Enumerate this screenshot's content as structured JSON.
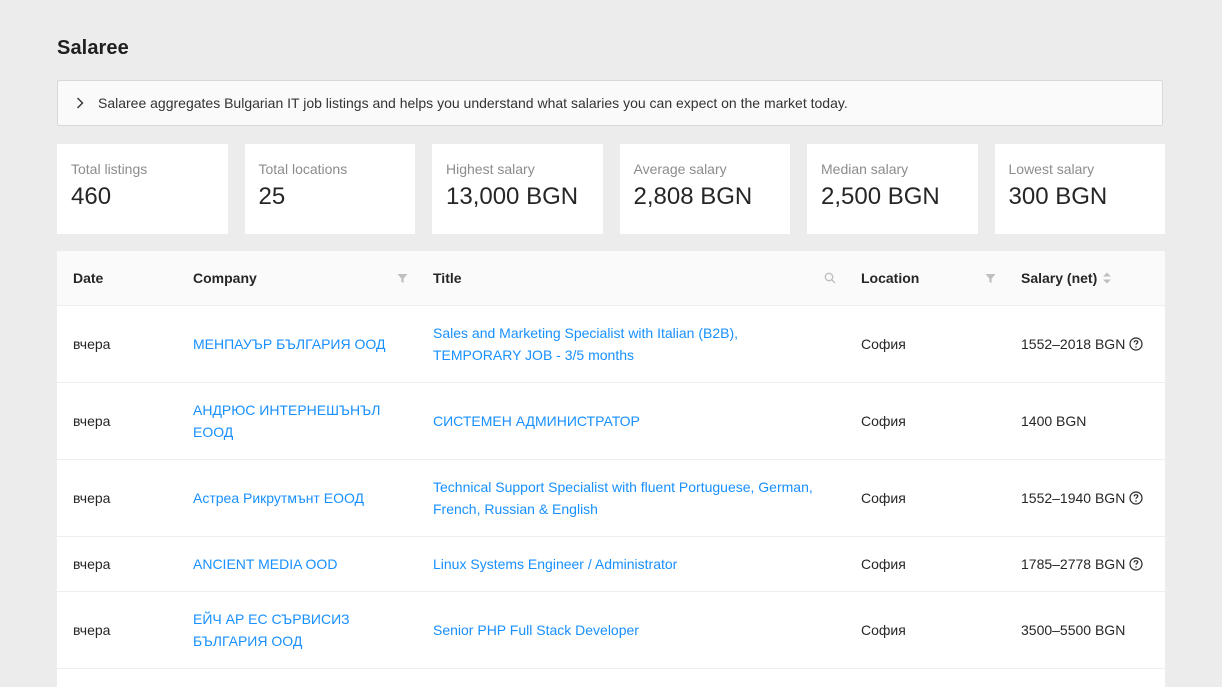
{
  "app": {
    "title": "Salaree"
  },
  "info": {
    "text": "Salaree aggregates Bulgarian IT job listings and helps you understand what salaries you can expect on the market today."
  },
  "stats": [
    {
      "label": "Total listings",
      "value": "460"
    },
    {
      "label": "Total locations",
      "value": "25"
    },
    {
      "label": "Highest salary",
      "value": "13,000 BGN"
    },
    {
      "label": "Average salary",
      "value": "2,808 BGN"
    },
    {
      "label": "Median salary",
      "value": "2,500 BGN"
    },
    {
      "label": "Lowest salary",
      "value": "300 BGN"
    }
  ],
  "table": {
    "columns": {
      "date": "Date",
      "company": "Company",
      "title": "Title",
      "location": "Location",
      "salary": "Salary (net)"
    },
    "rows": [
      {
        "date": "вчера",
        "company": "МЕНПАУЪР БЪЛГАРИЯ ООД",
        "title": "Sales and Marketing Specialist with Italian (B2B), TEMPORARY JOB - 3/5 months",
        "location": "София",
        "salary": "1552–2018 BGN",
        "has_help": true
      },
      {
        "date": "вчера",
        "company": "АНДРЮС ИНТЕРНЕШЪНЪЛ ЕООД",
        "title": "СИСТЕМЕН АДМИНИСТРАТОР",
        "location": "София",
        "salary": "1400 BGN",
        "has_help": false
      },
      {
        "date": "вчера",
        "company": "Астреа Рикрутмънт ЕООД",
        "title": "Technical Support Specialist with fluent Portuguese, German, French, Russian & English",
        "location": "София",
        "salary": "1552–1940 BGN",
        "has_help": true
      },
      {
        "date": "вчера",
        "company": "ANCIENT MEDIA OOD",
        "title": "Linux Systems Engineer / Administrator",
        "location": "София",
        "salary": "1785–2778 BGN",
        "has_help": true
      },
      {
        "date": "вчера",
        "company": "ЕЙЧ АР ЕС СЪРВИСИЗ БЪЛГАРИЯ ООД",
        "title": "Senior PHP Full Stack Developer",
        "location": "София",
        "salary": "3500–5500 BGN",
        "has_help": false
      }
    ]
  },
  "colors": {
    "link": "#1890ff",
    "background": "#ececec",
    "header_bg": "#fafafa"
  },
  "icons": {
    "expand": "chevron-right-icon",
    "filter": "filter-icon",
    "search": "search-icon",
    "sort": "sort-icon",
    "help": "question-circle-icon"
  }
}
